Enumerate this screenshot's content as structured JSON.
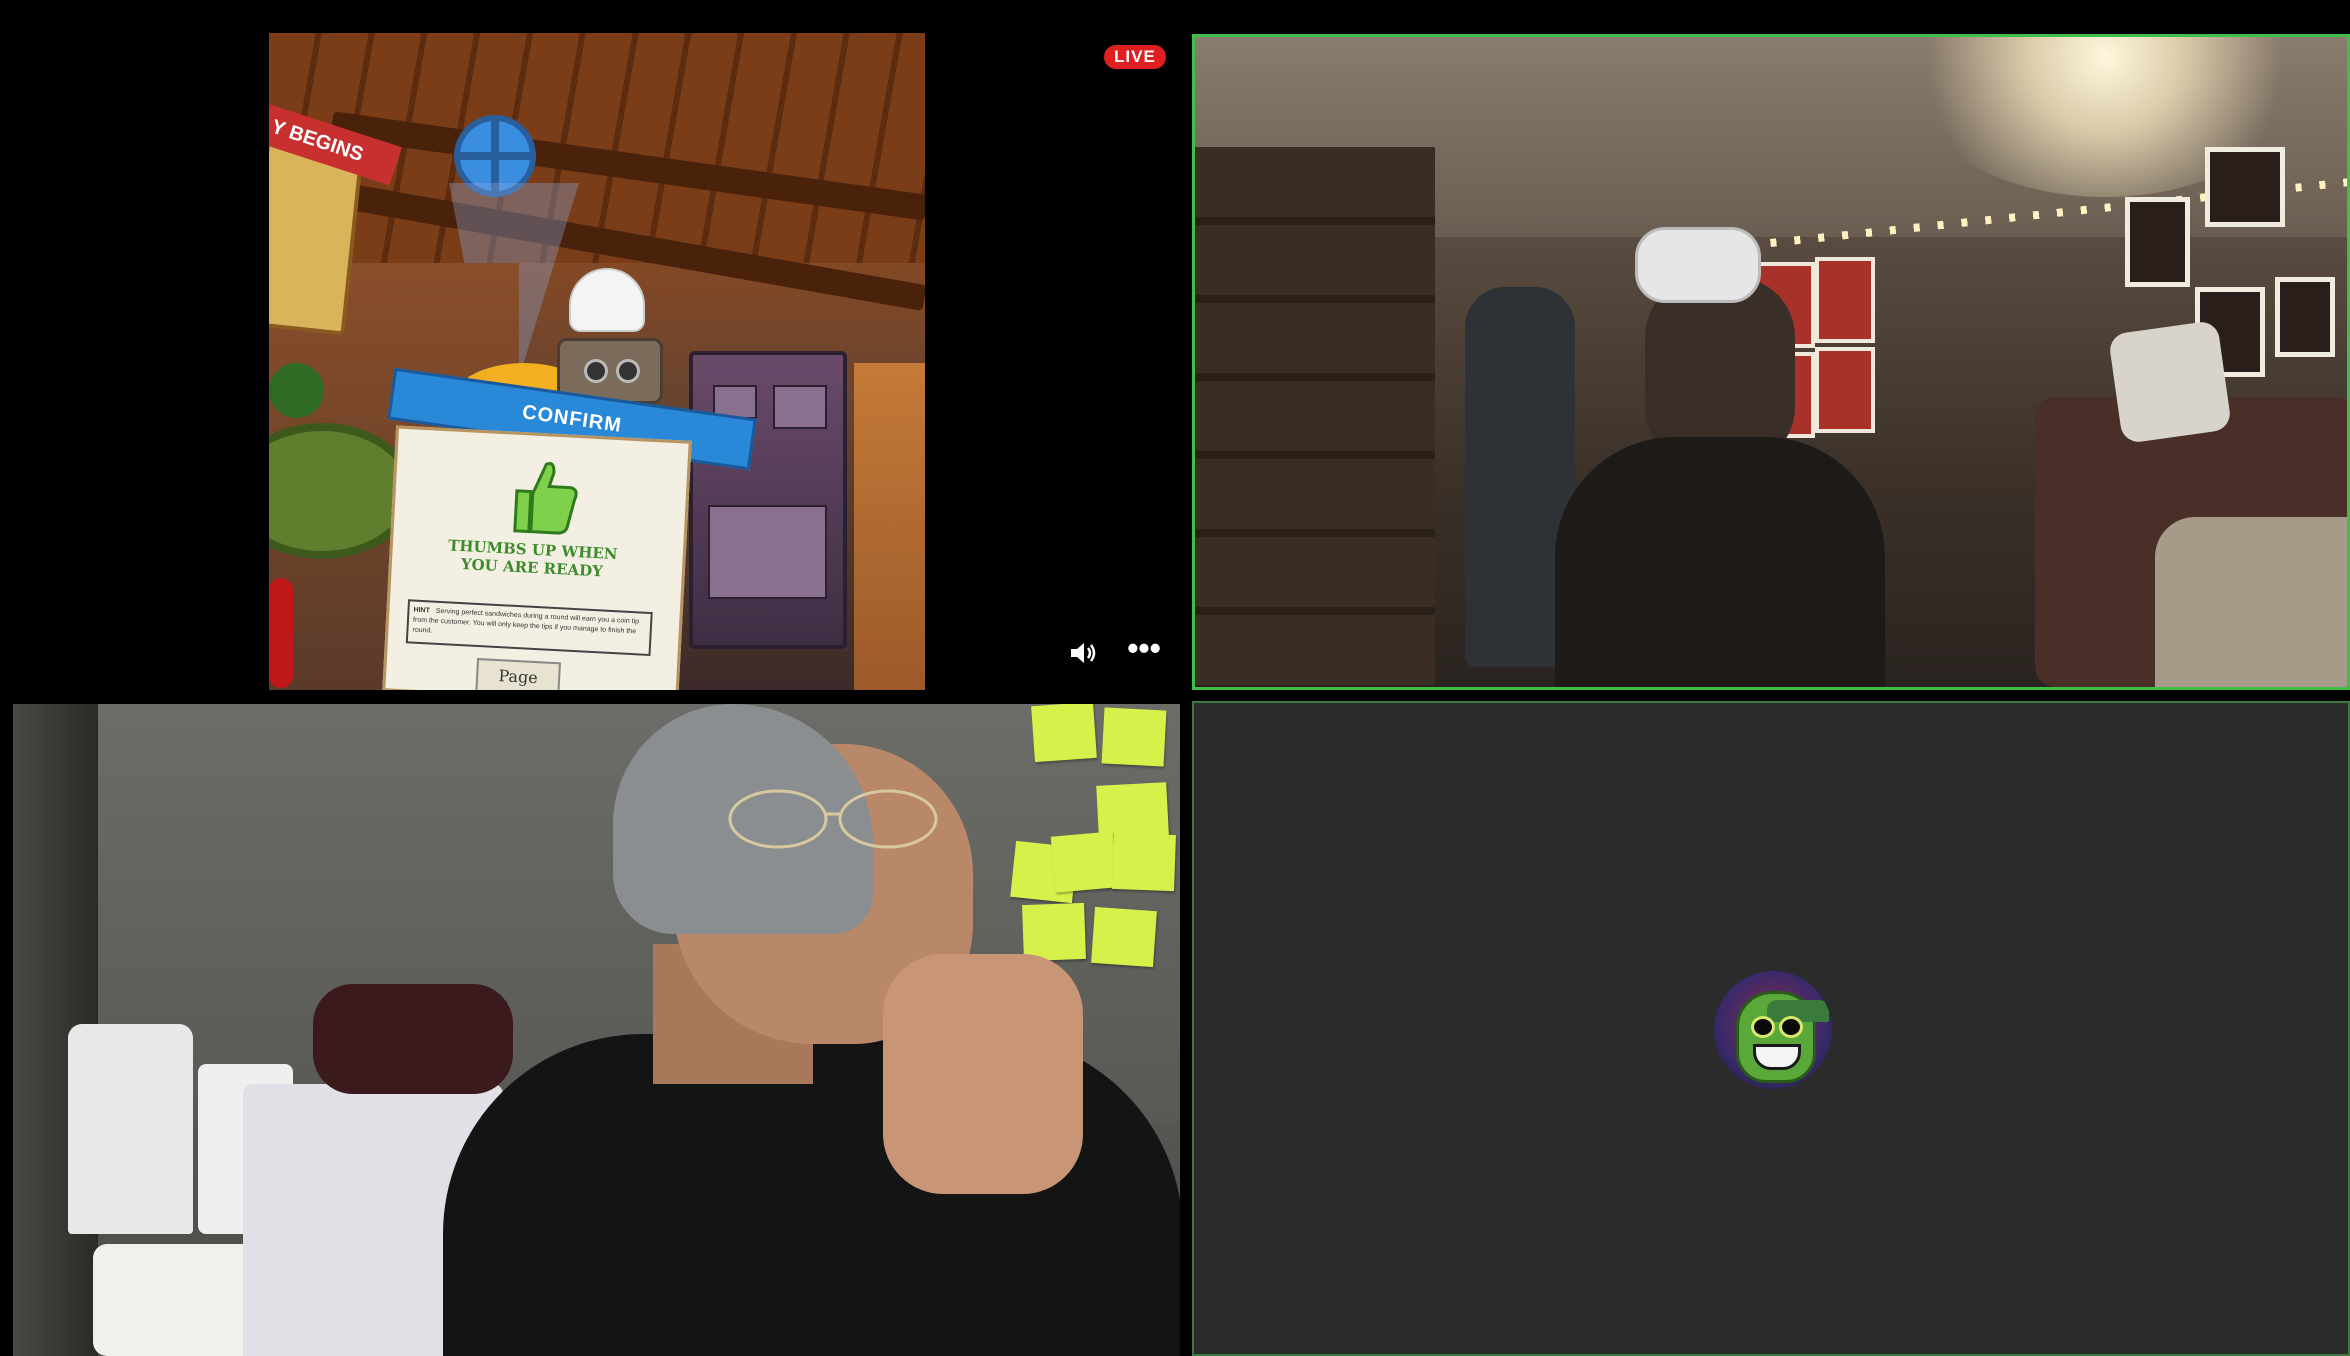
{
  "stream": {
    "live_label": "LIVE"
  },
  "screen_share": {
    "game_menu_banner": "Y BEGINS",
    "confirm_label": "CONFIRM",
    "card_title": "THUMBS UP WHEN YOU ARE READY",
    "hint_label": "HINT",
    "hint_text": "Serving perfect sandwiches during a round will earn you a coin tip from the customer. You will only keep the tips if you manage to finish the round.",
    "page_label": "Page",
    "controls": {
      "volume_icon": "speaker-volume-icon",
      "more_label": "•••"
    }
  },
  "participants": [
    {
      "tile": "active-speaker-webcam",
      "highlight_color": "#3fbf4a"
    },
    {
      "tile": "webcam"
    },
    {
      "tile": "avatar-only",
      "avatar_icon": "green-grinning-face-avatar"
    }
  ],
  "colors": {
    "live_badge": "#e02020",
    "tile_background": "#2b2b2b",
    "app_background": "#000000"
  }
}
